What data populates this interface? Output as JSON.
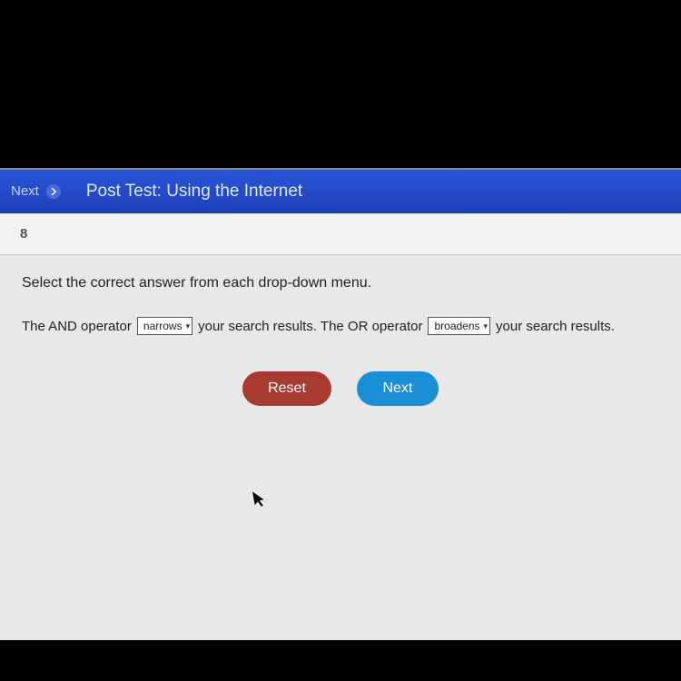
{
  "nav": {
    "next_label": "Next",
    "title": "Post Test: Using the Internet"
  },
  "question": {
    "number": "8",
    "instruction": "Select the correct answer from each drop-down menu.",
    "part1": "The AND operator",
    "dropdown1_value": "narrows",
    "part2": "your search results. The OR operator",
    "dropdown2_value": "broadens",
    "part3": "your search results."
  },
  "buttons": {
    "reset": "Reset",
    "next": "Next"
  }
}
